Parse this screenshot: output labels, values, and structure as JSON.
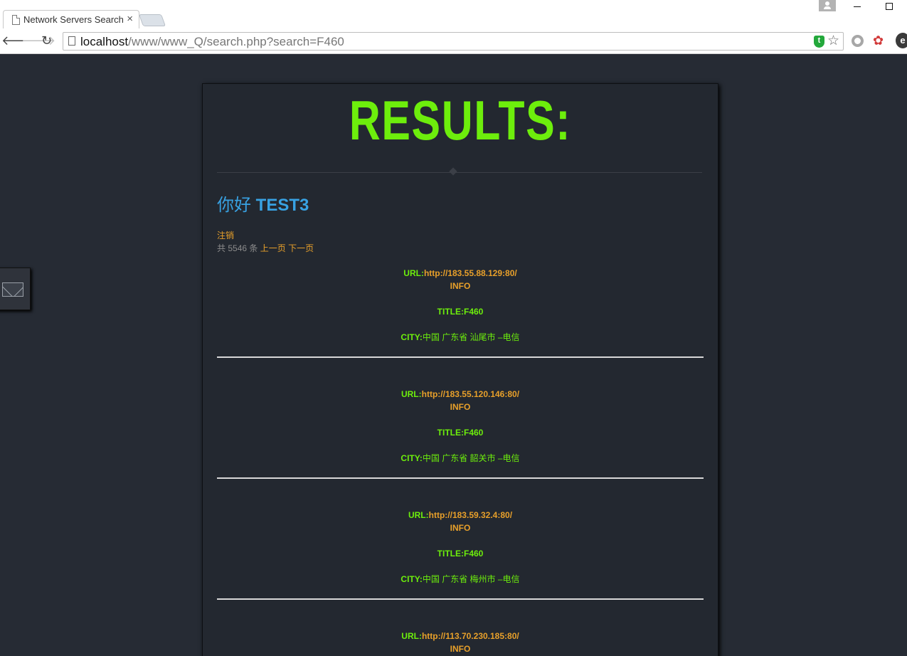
{
  "browser": {
    "tab_title": "Network Servers Search",
    "url_host": "localhost",
    "url_path": "/www/www_Q/search.php?search=F460"
  },
  "page": {
    "heading": "RESULTS:",
    "greeting_prefix": "你好",
    "username": "TEST3",
    "logout_label": "注销",
    "total_prefix": "共",
    "total_count": "5546",
    "total_suffix": "条",
    "prev_label": "上一页",
    "next_label": "下一页"
  },
  "labels": {
    "url": "URL:",
    "info": "INFO",
    "title": "TITLE:",
    "city": "CITY:"
  },
  "results": [
    {
      "url": "http://183.55.88.129:80/",
      "title": "F460",
      "city": "中国 广东省 汕尾市 –电信"
    },
    {
      "url": "http://183.55.120.146:80/",
      "title": "F460",
      "city": "中国 广东省 韶关市 –电信"
    },
    {
      "url": "http://183.59.32.4:80/",
      "title": "F460",
      "city": "中国 广东省 梅州市 –电信"
    },
    {
      "url": "http://113.70.230.185:80/",
      "title": "",
      "city": ""
    }
  ],
  "colors": {
    "background": "#262b34",
    "panel": "#232830",
    "accent_green": "#6dee0c",
    "accent_orange": "#e8a02a",
    "accent_blue": "#38a2e3"
  }
}
